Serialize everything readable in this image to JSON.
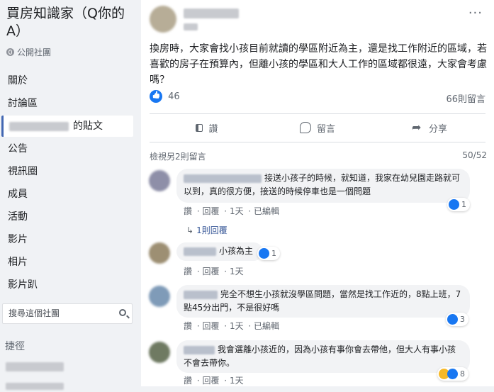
{
  "sidebar": {
    "group_title": "買房知識家（Q你的A）",
    "privacy": "公開社團",
    "nav": [
      {
        "label": "關於"
      },
      {
        "label": "討論區"
      },
      {
        "label": "的貼文"
      },
      {
        "label": "公告"
      },
      {
        "label": "視訊圈"
      },
      {
        "label": "成員"
      },
      {
        "label": "活動"
      },
      {
        "label": "影片"
      },
      {
        "label": "相片"
      },
      {
        "label": "影片趴"
      }
    ],
    "search_placeholder": "搜尋這個社團",
    "shortcuts_label": "捷徑"
  },
  "post": {
    "more": "···",
    "body": "換房時，大家會找小孩目前就讀的學區附近為主，還是找工作附近的區域，若喜歡的房子在預算內，但離小孩的學區和大人工作的區域都很遠，大家會考慮嗎？",
    "reaction_count": "46",
    "comment_count": "66則留言",
    "actions": {
      "like": "讚",
      "comment": "留言",
      "share": "分享"
    },
    "view_more": "檢視另2則留言",
    "pagination": "50/52"
  },
  "comments": [
    {
      "text": "接送小孩子的時候，就知道，我家在幼兒園走路就可以到，真的很方便，接送的時候停車也是一個問題",
      "like": "讚",
      "reply": "回覆",
      "time": "1天",
      "edited": "已編輯",
      "reactions": "1",
      "replies": "1則回覆"
    },
    {
      "text": "小孩為主",
      "like": "讚",
      "reply": "回覆",
      "time": "1天",
      "reactions": "1"
    },
    {
      "text": "完全不想生小孩就沒學區問題，當然是找工作近的，8點上班，7點45分出門，不是很好嗎",
      "like": "讚",
      "reply": "回覆",
      "time": "1天",
      "edited": "已編輯",
      "reactions": "3"
    },
    {
      "text": "我會選離小孩近的，因為小孩有事你會去帶他，但大人有事小孩不會去帶你。",
      "like": "讚",
      "reply": "回覆",
      "time": "1天",
      "reactions": "8"
    }
  ],
  "colors": {
    "accent": "#1877f2",
    "link": "#385898",
    "haha": "#f7b928"
  }
}
